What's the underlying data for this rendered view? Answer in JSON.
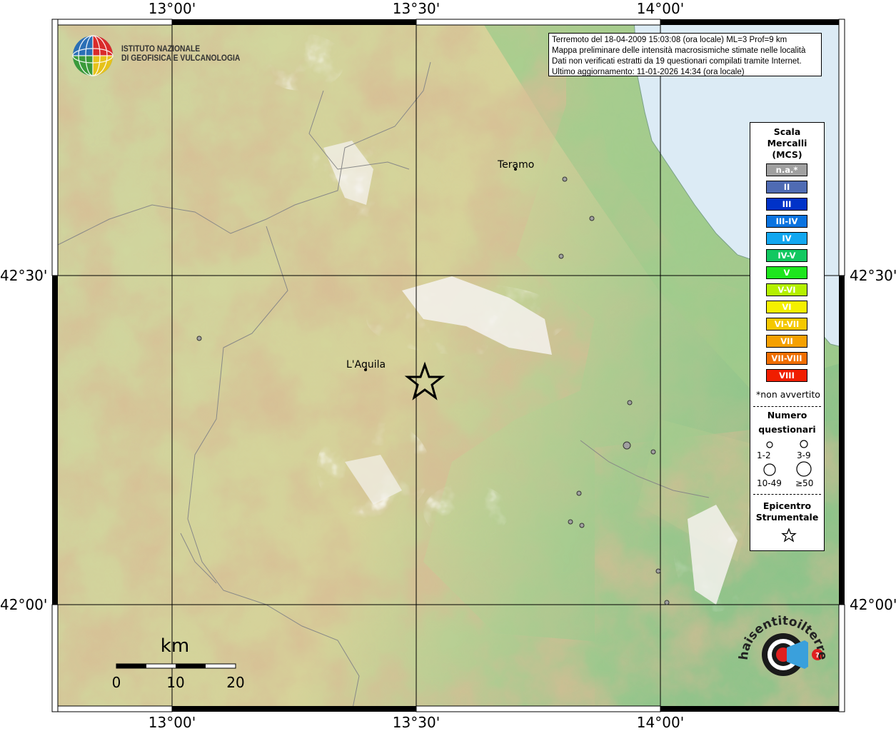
{
  "axes": {
    "longitude_labels": [
      "13°00'",
      "13°30'",
      "14°00'"
    ],
    "latitude_labels": [
      "42°30'",
      "42°00'"
    ]
  },
  "info_box": {
    "line1": "Terremoto del 18-04-2009 15:03:08 (ora locale) ML=3 Prof=9 km",
    "line2": "Mappa preliminare delle intensità macrosismiche stimate nelle località",
    "line3": "Dati non verificati estratti da 19 questionari compilati tramite Internet.",
    "line4": "Ultimo aggiornamento: 11-01-2026 14:34 (ora locale)"
  },
  "institute": {
    "line1": "ISTITUTO NAZIONALE",
    "line2": "DI GEOFISICA E VULCANOLOGIA"
  },
  "cities": [
    {
      "name": "Teramo"
    },
    {
      "name": "L'Aquila"
    }
  ],
  "legend": {
    "title_line1": "Scala",
    "title_line2": "Mercalli",
    "title_line3": "(MCS)",
    "levels": [
      {
        "label": "n.a.*",
        "color": "#a0a0a0"
      },
      {
        "label": "II",
        "color": "#4f6bb3"
      },
      {
        "label": "III",
        "color": "#0032c8"
      },
      {
        "label": "III-IV",
        "color": "#0a73e0"
      },
      {
        "label": "IV",
        "color": "#12a7f0"
      },
      {
        "label": "IV-V",
        "color": "#12c860"
      },
      {
        "label": "V",
        "color": "#1ee61e"
      },
      {
        "label": "V-VI",
        "color": "#b4f000"
      },
      {
        "label": "VI",
        "color": "#f5f000"
      },
      {
        "label": "VI-VII",
        "color": "#f5c800"
      },
      {
        "label": "VII",
        "color": "#f5a000"
      },
      {
        "label": "VII-VIII",
        "color": "#f06e00"
      },
      {
        "label": "VIII",
        "color": "#f01e00"
      }
    ],
    "na_note": "*non avvertito",
    "count_title_line1": "Numero",
    "count_title_line2": "questionari",
    "count_labels": [
      "1-2",
      "3-9",
      "10-49",
      "≥50"
    ],
    "epicenter_line1": "Epicentro",
    "epicenter_line2": "Strumentale"
  },
  "scale_bar": {
    "unit": "km",
    "ticks": [
      "0",
      "10",
      "20"
    ]
  },
  "observation_intensity": "n.a.*",
  "observation_color": "#a0a0a0",
  "website_logo": "haisentitoilterremoto.it / www."
}
